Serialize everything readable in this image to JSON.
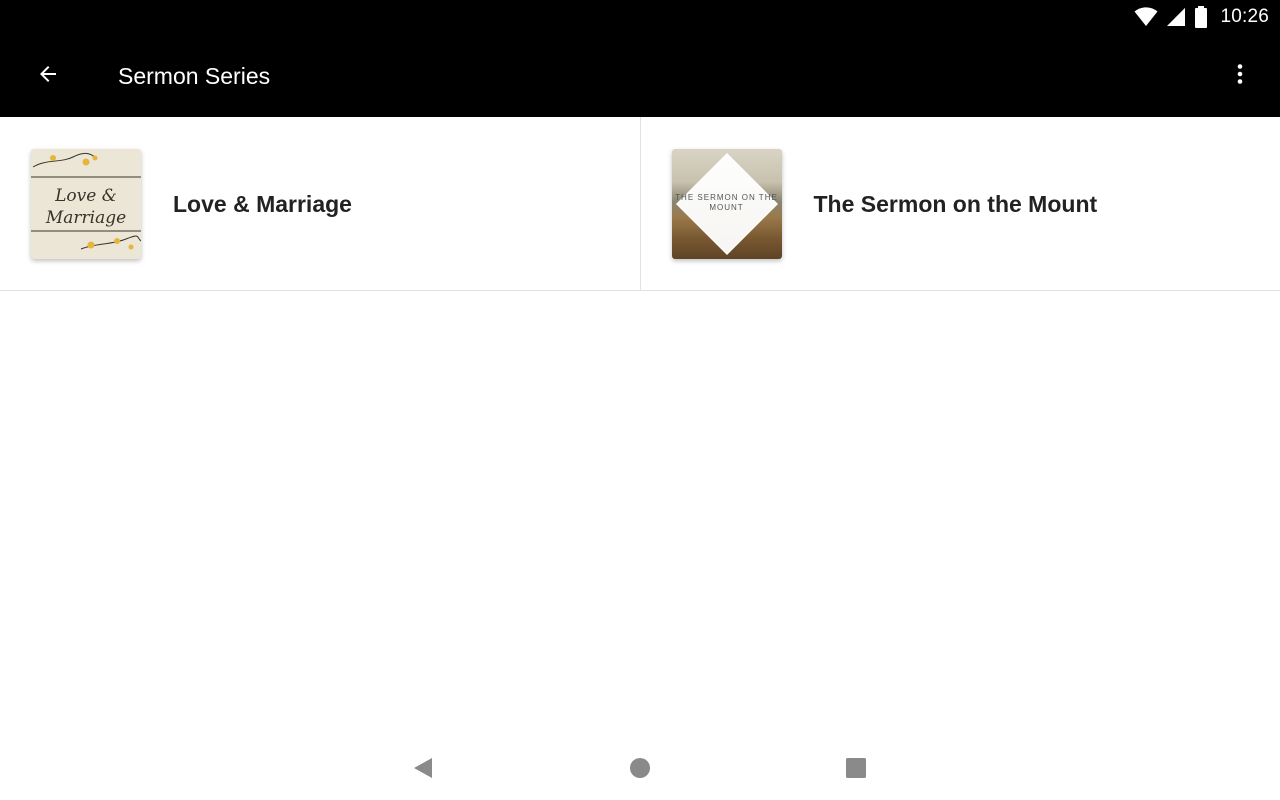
{
  "status_bar": {
    "time": "10:26",
    "icons": [
      "wifi-icon",
      "cell-signal-icon",
      "battery-icon"
    ]
  },
  "app_bar": {
    "title": "Sermon Series",
    "back_icon": "arrow-back-icon",
    "menu_icon": "more-vert-icon"
  },
  "series": [
    {
      "label": "Love & Marriage",
      "thumbnail_text_line1": "Love &",
      "thumbnail_text_line2": "Marriage"
    },
    {
      "label": "The Sermon on the Mount",
      "thumbnail_text": "THE SERMON ON THE MOUNT"
    }
  ],
  "nav_bar": {
    "icons": [
      "nav-back-icon",
      "nav-home-icon",
      "nav-recents-icon"
    ]
  },
  "colors": {
    "app_bar_bg": "#000000",
    "app_bar_text": "#ffffff",
    "tile_text": "#222222",
    "divider": "#e2e2e2",
    "nav_icon": "#8a8a8a"
  }
}
